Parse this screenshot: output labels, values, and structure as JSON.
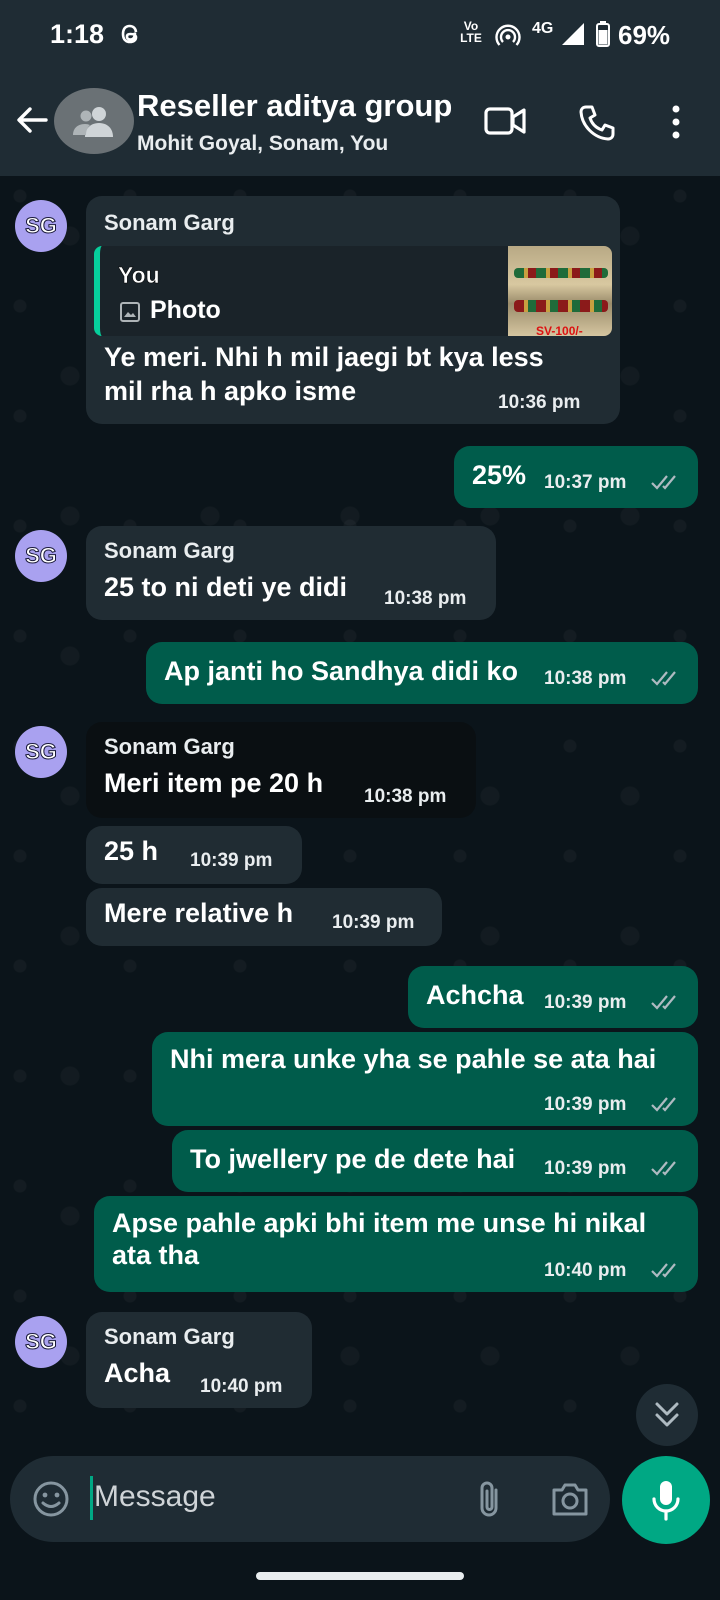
{
  "status_bar": {
    "time": "1:18",
    "volte_label_top": "Vo",
    "volte_label_bottom": "LTE",
    "network": "4G",
    "battery_percent": "69%"
  },
  "header": {
    "title": "Reseller aditya group",
    "subtitle": "Mohit Goyal, Sonam, You"
  },
  "messages": [
    {
      "direction": "in",
      "avatar": "SG",
      "sender": "Sonam Garg",
      "quote": {
        "author": "You",
        "type": "Photo",
        "thumb_text": "SV-100/-"
      },
      "text_line1": "Ye meri. Nhi h mil jaegi bt kya less",
      "text_line2": "mil rha h apko isme",
      "time": "10:36 pm"
    },
    {
      "direction": "out",
      "text": "25%",
      "time": "10:37 pm"
    },
    {
      "direction": "in",
      "avatar": "SG",
      "sender": "Sonam Garg",
      "text": "25 to ni deti ye didi",
      "time": "10:38 pm"
    },
    {
      "direction": "out",
      "text": "Ap janti ho Sandhya didi ko",
      "time": "10:38 pm"
    },
    {
      "direction": "in",
      "avatar": "SG",
      "sender": "Sonam Garg",
      "text": "Meri item pe 20 h",
      "time": "10:38 pm"
    },
    {
      "direction": "in",
      "text": "25 h",
      "time": "10:39 pm"
    },
    {
      "direction": "in",
      "text": "Mere relative h",
      "time": "10:39 pm"
    },
    {
      "direction": "out",
      "text": "Achcha",
      "time": "10:39 pm"
    },
    {
      "direction": "out",
      "text": "Nhi mera unke yha se pahle se ata hai",
      "time": "10:39 pm"
    },
    {
      "direction": "out",
      "text": "To jwellery pe de dete hai",
      "time": "10:39 pm"
    },
    {
      "direction": "out",
      "text_line1": "Apse pahle apki bhi item me unse hi nikal",
      "text_line2": "ata tha",
      "time": "10:40 pm"
    },
    {
      "direction": "in",
      "avatar": "SG",
      "sender": "Sonam Garg",
      "text": "Acha",
      "time": "10:40 pm"
    }
  ],
  "composer": {
    "placeholder": "Message"
  },
  "icons": {
    "back": "arrow-left-icon",
    "group_avatar": "group-icon",
    "video": "video-call-icon",
    "call": "phone-icon",
    "more": "more-vert-icon",
    "emoji": "emoji-icon",
    "attach": "paperclip-icon",
    "camera": "camera-icon",
    "mic": "mic-icon",
    "scroll": "chevron-double-down-icon",
    "read": "double-check-icon"
  },
  "colors": {
    "background": "#0b141a",
    "header": "#1f2c34",
    "incoming_bubble": "#202c33",
    "outgoing_bubble": "#005c4b",
    "accent": "#00a884",
    "avatar_sg": "#a9a1f0"
  }
}
